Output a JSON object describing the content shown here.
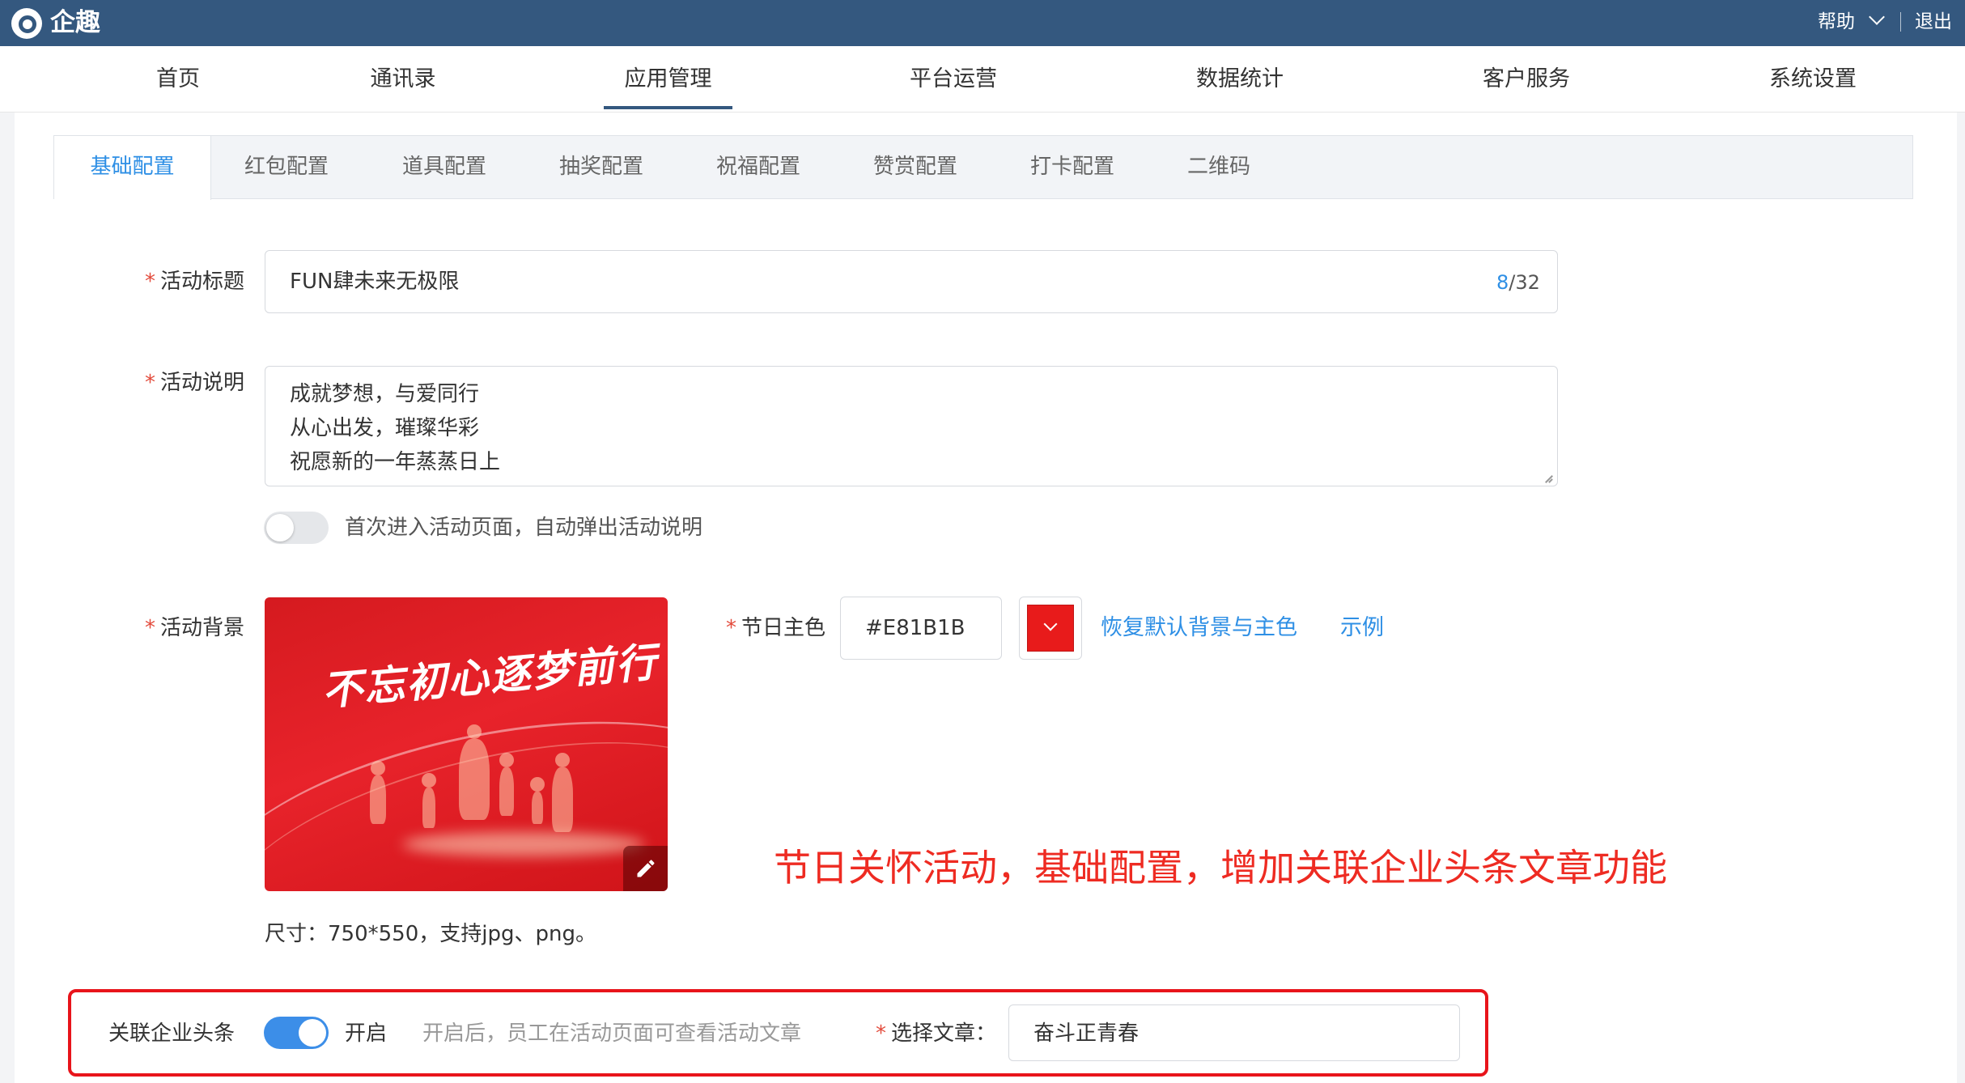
{
  "topbar": {
    "logo_text": "企趣",
    "help_label": "帮助",
    "logout_label": "退出"
  },
  "nav": {
    "items": [
      {
        "label": "首页"
      },
      {
        "label": "通讯录"
      },
      {
        "label": "应用管理"
      },
      {
        "label": "平台运营"
      },
      {
        "label": "数据统计"
      },
      {
        "label": "客户服务"
      },
      {
        "label": "系统设置"
      }
    ],
    "active_index": 2
  },
  "subtabs": {
    "items": [
      {
        "label": "基础配置"
      },
      {
        "label": "红包配置"
      },
      {
        "label": "道具配置"
      },
      {
        "label": "抽奖配置"
      },
      {
        "label": "祝福配置"
      },
      {
        "label": "赞赏配置"
      },
      {
        "label": "打卡配置"
      },
      {
        "label": "二维码"
      }
    ],
    "active_index": 0
  },
  "form": {
    "required_mark": "*",
    "title": {
      "label": "活动标题",
      "value": "FUN肆未来无极限",
      "count_current": "8",
      "count_max": "/32"
    },
    "description": {
      "label": "活动说明",
      "lines": [
        "成就梦想，与爱同行",
        "从心出发，璀璨华彩",
        "祝愿新的一年蒸蒸日上"
      ],
      "auto_popup_label": "首次进入活动页面，自动弹出活动说明",
      "auto_popup_on": false
    },
    "background": {
      "label": "活动背景",
      "image_slogan": "不忘初心逐梦前行",
      "size_hint": "尺寸：750*550，支持jpg、png。"
    },
    "theme_color": {
      "label": "节日主色",
      "value": "#E81B1B",
      "reset_link": "恢复默认背景与主色",
      "example_link": "示例"
    },
    "linked_news": {
      "label": "关联企业头条",
      "enabled": true,
      "state_label": "开启",
      "hint": "开启后，员工在活动页面可查看活动文章",
      "article_label": "选择文章：",
      "article_value": "奋斗正青春"
    }
  },
  "annotation": {
    "note": "节日关怀活动，基础配置，增加关联企业头条文章功能"
  },
  "colors": {
    "topbar": "#34587f",
    "accent": "#2e8fe5",
    "theme": "#E81B1B",
    "annotation": "#ee2b22"
  }
}
